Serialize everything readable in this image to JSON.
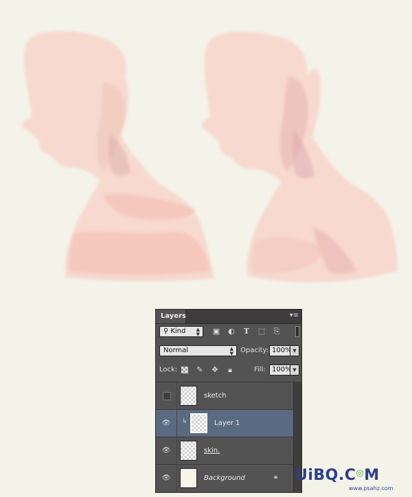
{
  "panel": {
    "tab_label": "Layers",
    "menu_icon": "panel-menu-icon",
    "filter": {
      "kind_label": "Kind",
      "search_icon": "magnifier-icon"
    },
    "blend_mode": "Normal",
    "opacity_label": "Opacity:",
    "opacity_value": "100%",
    "lock_label": "Lock:",
    "fill_label": "Fill:",
    "fill_value": "100%"
  },
  "layers": [
    {
      "name": "sketch",
      "visible": false,
      "selected": false
    },
    {
      "name": "Layer 1",
      "visible": true,
      "selected": true,
      "clipped": true
    },
    {
      "name": "skin.",
      "visible": true,
      "selected": false
    },
    {
      "name": "Background",
      "visible": true,
      "selected": false,
      "locked": true
    }
  ],
  "watermark": {
    "main_a": "UiBQ.C",
    "main_b": "M",
    "sub": "www.psahz.com"
  },
  "colors": {
    "panel": "#535353",
    "selected_row": "#5a6a80",
    "skin": "#f5cfc4",
    "canvas": "#f4f3ea"
  }
}
